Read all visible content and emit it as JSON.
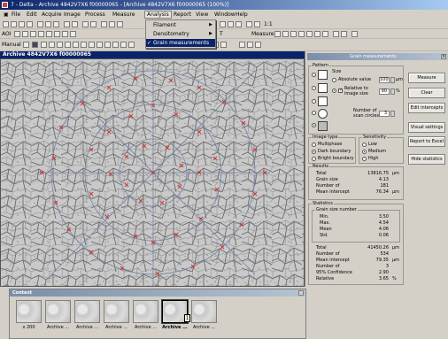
{
  "window": {
    "title": "7 - Delta - Archive 4842V7X6 f00000065 - [Archive 4842V7X6 f00000065 (100%)]"
  },
  "menu": {
    "items": [
      "File",
      "Edit",
      "Acquire",
      "Image",
      "Process",
      "Measure",
      "Analysis",
      "Report",
      "View",
      "Window",
      "Help"
    ],
    "active_item": "Analysis"
  },
  "analysis_menu": {
    "items": [
      {
        "label": "Filament",
        "has_submenu": true,
        "checked": false,
        "selected": false
      },
      {
        "label": "Densitometry",
        "has_submenu": true,
        "checked": false,
        "selected": false
      },
      {
        "label": "Grain measurements",
        "has_submenu": false,
        "checked": true,
        "selected": true
      }
    ]
  },
  "toolbars": {
    "row2_left": "AOI",
    "row2_mid": "T",
    "row2_measure": "Measure",
    "row3_left": "Manual",
    "zoom_label": "1:1"
  },
  "image_window": {
    "title": "Archive 4842V7X6 f00000065"
  },
  "grain_panel": {
    "title": "Grain measurements",
    "pattern": {
      "label": "Pattern",
      "size_label": "Size",
      "absolute_label": "Absolute value",
      "absolute_value": "100",
      "absolute_unit": "µm",
      "relative_label": "Relative to image size",
      "relative_value": "90",
      "relative_unit": "%",
      "circles_label": "Number of scan circles",
      "circles_value": "3"
    },
    "image_type": {
      "label": "Image type",
      "options": [
        "Multiphase",
        "Dark boundary",
        "Bright boundary"
      ],
      "selected": "Dark boundary"
    },
    "sensitivity": {
      "label": "Sensitivity",
      "options": [
        "Low",
        "Medium",
        "High"
      ],
      "selected": "Medium"
    },
    "results": {
      "label": "Results",
      "rows": [
        {
          "label": "Total",
          "value": "13816.75",
          "unit": "µm"
        },
        {
          "label": "Grain size",
          "value": "4.13",
          "unit": ""
        },
        {
          "label": "Number of",
          "value": "181",
          "unit": ""
        },
        {
          "label": "Mean intercept",
          "value": "76.34",
          "unit": "µm"
        }
      ]
    },
    "statistics": {
      "label": "Statistics",
      "grain_size_label": "Grain size number",
      "grain_rows": [
        {
          "label": "Min.",
          "value": "3.50"
        },
        {
          "label": "Max.",
          "value": "4.54"
        },
        {
          "label": "Mean",
          "value": "4.06"
        },
        {
          "label": "Std.",
          "value": "0.06"
        }
      ],
      "rows": [
        {
          "label": "Total",
          "value": "41450.26",
          "unit": "µm"
        },
        {
          "label": "Number of",
          "value": "534",
          "unit": ""
        },
        {
          "label": "Mean intercept",
          "value": "79.35",
          "unit": "µm"
        },
        {
          "label": "Number of",
          "value": "3",
          "unit": ""
        },
        {
          "label": "95% Confidence",
          "value": "2.90",
          "unit": ""
        },
        {
          "label": "Relative",
          "value": "3.65",
          "unit": "%"
        }
      ]
    },
    "buttons": [
      "Measure",
      "Clear",
      "Edit intercepts",
      "Visual settings",
      "Report to Excel",
      "Hide statistics"
    ]
  },
  "context": {
    "title": "Context",
    "thumbnails": [
      "x 200",
      "Archive ...",
      "Archive ...",
      "Archive ...",
      "Archive ...",
      "Archive ...",
      "Archive ..."
    ],
    "selected_index": 5,
    "badge": "1"
  }
}
